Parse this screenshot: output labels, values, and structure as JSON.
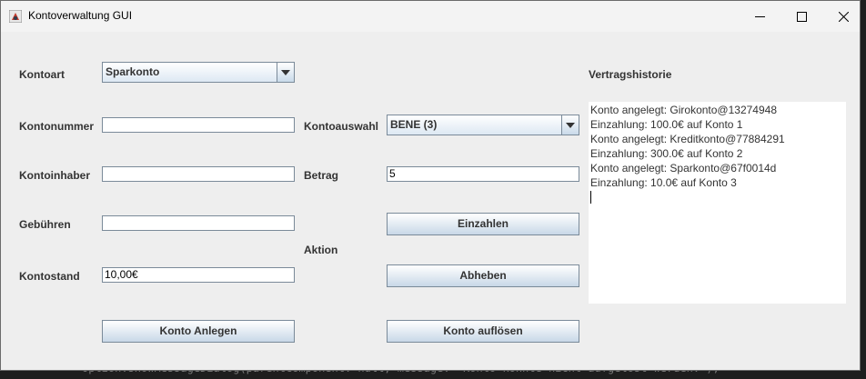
{
  "window": {
    "title": "Kontoverwaltung GUI",
    "controls": {
      "minimize": "minimize-icon",
      "maximize": "maximize-icon",
      "close": "close-icon"
    }
  },
  "form": {
    "kontoart_label": "Kontoart",
    "kontoart_value": "Sparkonto",
    "kontonummer_label": "Kontonummer",
    "kontonummer_value": "",
    "kontoinhaber_label": "Kontoinhaber",
    "kontoinhaber_value": "",
    "gebuehren_label": "Gebühren",
    "gebuehren_value": "",
    "kontostand_label": "Kontostand",
    "kontostand_value": "10,00€",
    "anlegen_button": "Konto Anlegen"
  },
  "actions": {
    "kontoauswahl_label": "Kontoauswahl",
    "kontoauswahl_value": "BENE (3)",
    "betrag_label": "Betrag",
    "betrag_value": "5",
    "aktion_label": "Aktion",
    "einzahlen_button": "Einzahlen",
    "abheben_button": "Abheben",
    "aufloesen_button": "Konto auflösen"
  },
  "history": {
    "label": "Vertragshistorie",
    "lines": [
      "Konto angelegt: Girokonto@13274948",
      "Einzahlung: 100.0€ auf Konto 1",
      "Konto angelegt: Kreditkonto@77884291",
      "Einzahlung: 300.0€ auf Konto 2",
      "Konto angelegt: Sparkonto@67f0014d",
      "Einzahlung: 10.0€ auf Konto 3"
    ]
  },
  "background_code": "    Option.showMessageDialog(parentComponent: null, message: \"Konto konnte nicht aufgelöst werden.\");"
}
